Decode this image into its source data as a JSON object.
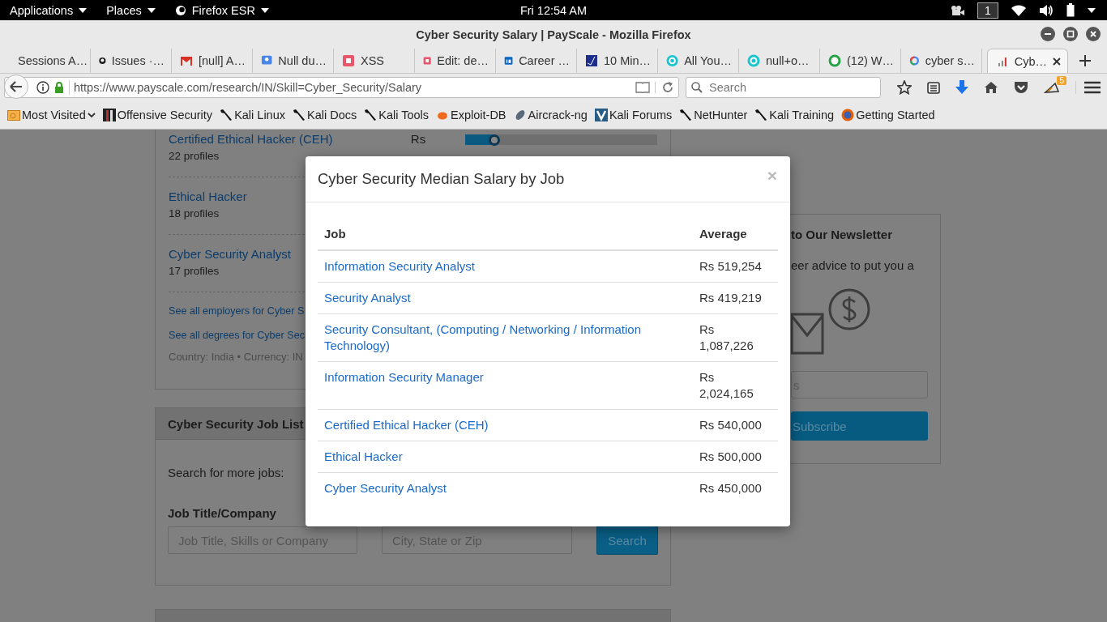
{
  "desktop_bar": {
    "menus": [
      {
        "label": "Applications"
      },
      {
        "label": "Places"
      },
      {
        "label": "Firefox ESR"
      }
    ],
    "clock": "Fri 12:54 AM",
    "workspace": "1"
  },
  "window": {
    "title": "Cyber Security Salary | PayScale - Mozilla Firefox"
  },
  "tabs": [
    {
      "label": "Sessions A…",
      "selected": false
    },
    {
      "label": "Issues ·…",
      "selected": false
    },
    {
      "label": "[null] A…",
      "selected": false
    },
    {
      "label": "Null du…",
      "selected": false
    },
    {
      "label": "XSS",
      "selected": false
    },
    {
      "label": "Edit: de…",
      "selected": false
    },
    {
      "label": "Career …",
      "selected": false
    },
    {
      "label": "10 Min…",
      "selected": false
    },
    {
      "label": "All You…",
      "selected": false
    },
    {
      "label": "null+o…",
      "selected": false
    },
    {
      "label": "(12) W…",
      "selected": false
    },
    {
      "label": "cyber s…",
      "selected": false
    },
    {
      "label": "Cyb…",
      "selected": true
    }
  ],
  "nav": {
    "url": "https://www.payscale.com/research/IN/Skill=Cyber_Security/Salary",
    "search_placeholder": "Search",
    "addon_badge": "5"
  },
  "bookmarks": [
    {
      "label": "Most Visited"
    },
    {
      "label": "Offensive Security"
    },
    {
      "label": "Kali Linux"
    },
    {
      "label": "Kali Docs"
    },
    {
      "label": "Kali Tools"
    },
    {
      "label": "Exploit-DB"
    },
    {
      "label": "Aircrack-ng"
    },
    {
      "label": "Kali Forums"
    },
    {
      "label": "NetHunter"
    },
    {
      "label": "Kali Training"
    },
    {
      "label": "Getting Started"
    }
  ],
  "page": {
    "jobs_card": {
      "jobs": [
        {
          "title": "Certified Ethical Hacker (CEH)",
          "profiles": "22 profiles",
          "currency": "Rs",
          "level": 0.15
        },
        {
          "title": "Ethical Hacker",
          "profiles": "18 profiles"
        },
        {
          "title": "Cyber Security Analyst",
          "profiles": "17 profiles"
        }
      ],
      "links": [
        "See all employers for Cyber S",
        "See all degrees for Cyber Sec"
      ],
      "footnote": "Country: India • Currency: IN"
    },
    "job_search": {
      "heading": "Cyber Security Job List",
      "prompt": "Search for more jobs:",
      "field_label": "Job Title/Company",
      "fields": [
        {
          "placeholder": "Job Title, Skills or Company"
        },
        {
          "placeholder": "City, State or Zip"
        }
      ],
      "button": "Search"
    },
    "newsletter": {
      "heading": "to Our Newsletter",
      "text": "eer advice to put you a",
      "email_placeholder": "s",
      "button": "Subscribe"
    }
  },
  "modal": {
    "title": "Cyber Security Median Salary by Job",
    "close": "×",
    "columns": [
      "Job",
      "Average"
    ],
    "rows": [
      {
        "job": "Information Security Analyst",
        "average": "Rs 519,254"
      },
      {
        "job": "Security Analyst",
        "average": "Rs 419,219"
      },
      {
        "job": "Security Consultant, (Computing / Networking / Information Technology)",
        "average": "Rs 1,087,226"
      },
      {
        "job": "Information Security Manager",
        "average": "Rs 2,024,165"
      },
      {
        "job": "Certified Ethical Hacker (CEH)",
        "average": "Rs 540,000"
      },
      {
        "job": "Ethical Hacker",
        "average": "Rs 500,000"
      },
      {
        "job": "Cyber Security Analyst",
        "average": "Rs 450,000"
      }
    ]
  }
}
